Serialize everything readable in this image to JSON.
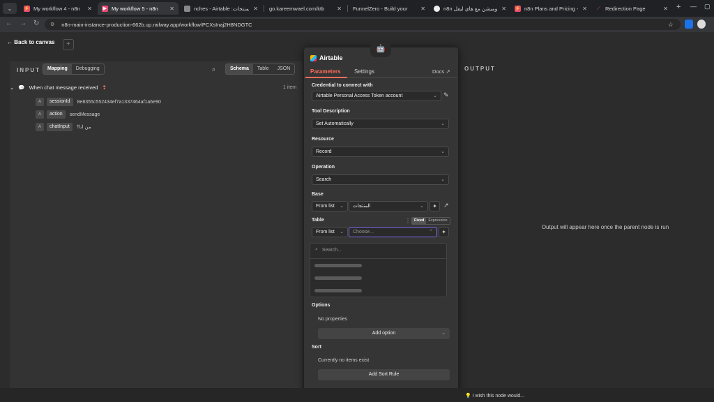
{
  "browser": {
    "tabs": [
      {
        "label": "My workflow 4 - n8n",
        "active": false
      },
      {
        "label": "My workflow 5 - n8n",
        "active": true
      },
      {
        "label": "nches - Airtable :المنتجات",
        "active": false
      },
      {
        "label": "go.kareemwael.com/ktb",
        "active": false
      },
      {
        "label": "FunnelZero - Build your",
        "active": false
      },
      {
        "label": "n8n اتوميشن مع هاي ليفل",
        "active": false
      },
      {
        "label": "n8n Plans and Pricing - n",
        "active": false
      },
      {
        "label": "Redirection Page",
        "active": false
      }
    ],
    "url": "n8n-main-instance-production-662b.up.railway.app/workflow/PCXsInaj2H8NDGTC"
  },
  "canvas": {
    "back_label": "Back to canvas",
    "plus": "+"
  },
  "input_panel": {
    "title": "INPUT",
    "mode_tabs": [
      "Mapping",
      "Debugging"
    ],
    "view_tabs": [
      "Schema",
      "Table",
      "JSON"
    ],
    "trigger": "When chat message received",
    "count": "1 item",
    "fields": [
      {
        "type": "A",
        "key": "sessionId",
        "value": "8e8355c552434ef7a1337464af1a6e90"
      },
      {
        "type": "A",
        "key": "action",
        "value": "sendMessage"
      },
      {
        "type": "A",
        "key": "chatInput",
        "value": "من انا؟"
      }
    ]
  },
  "output_panel": {
    "title": "OUTPUT",
    "message": "Output will appear here once the parent node is run"
  },
  "node": {
    "title": "Airtable",
    "tabs": [
      "Parameters",
      "Settings"
    ],
    "docs": "Docs",
    "credential_label": "Credential to connect with",
    "credential_value": "Airtable Personal Access Token account",
    "tool_desc_label": "Tool Description",
    "tool_desc_value": "Set Automatically",
    "resource_label": "Resource",
    "resource_value": "Record",
    "operation_label": "Operation",
    "operation_value": "Search",
    "base_label": "Base",
    "base_mode": "From list",
    "base_value": "المنتجات",
    "table_label": "Table",
    "table_toggle": [
      "Fixed",
      "Expression"
    ],
    "table_mode": "From list",
    "table_placeholder": "Choose...",
    "dropdown_search": "Search...",
    "options_label": "Options",
    "options_empty": "No properties",
    "add_option": "Add option",
    "sort_label": "Sort",
    "sort_empty": "Currently no items exist",
    "add_sort": "Add Sort Rule"
  },
  "footer": {
    "wish": "I wish this node would..."
  }
}
